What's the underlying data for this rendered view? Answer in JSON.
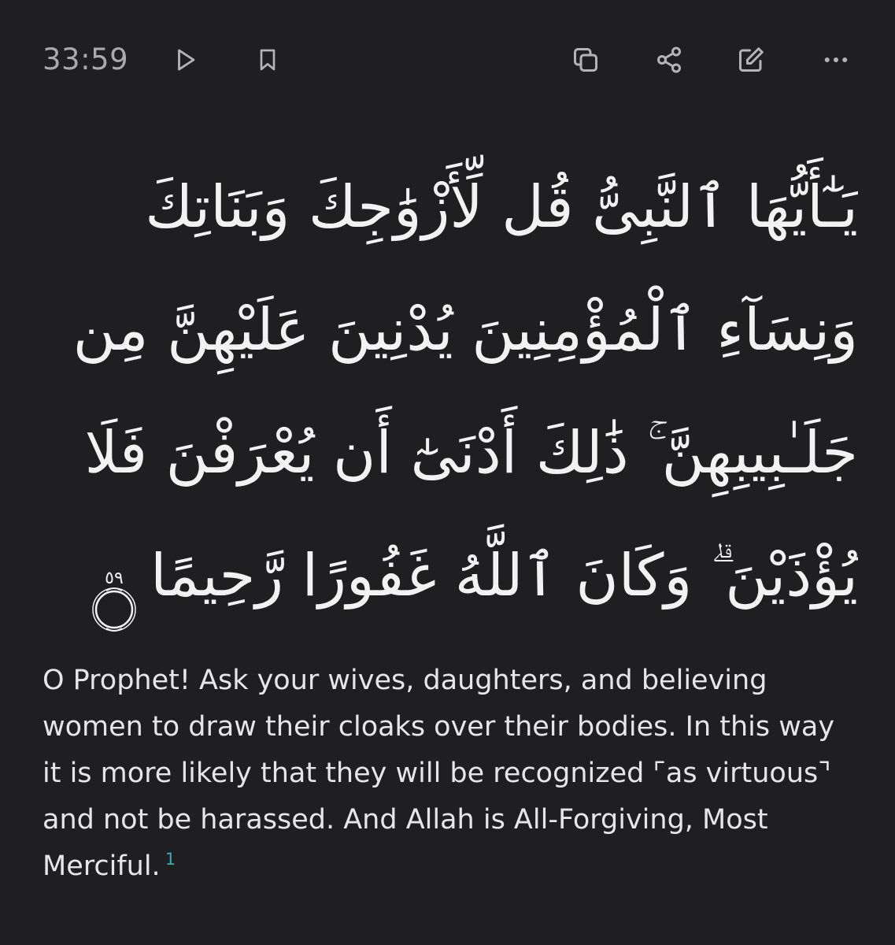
{
  "verse_ref": "33:59",
  "arabic_lines": [
    "يَـٰٓأَيُّهَا ٱلنَّبِىُّ قُل لِّأَزْوَٰجِكَ وَبَنَاتِكَ",
    "وَنِسَآءِ ٱلْمُؤْمِنِينَ يُدْنِينَ عَلَيْهِنَّ مِن",
    "جَلَـٰبِيبِهِنَّ ۚ ذَٰلِكَ أَدْنَىٰٓ أَن يُعْرَفْنَ فَلَا",
    "يُؤْذَيْنَ ۗ وَكَانَ ٱللَّهُ غَفُورًا رَّحِيمًا"
  ],
  "ayah_number": "٥٩",
  "translation": "O Prophet! Ask your wives, daughters, and believing women to draw their cloaks over their bodies. In this way it is more likely that they will be recognized ⌜as virtuous⌝ and not be harassed. And Allah is All-Forgiving, Most Merciful.",
  "footnote_marker": "1",
  "icons": {
    "play": "play-icon",
    "bookmark": "bookmark-icon",
    "copy": "copy-icon",
    "share": "share-icon",
    "edit": "edit-icon",
    "more": "more-icon"
  },
  "colors": {
    "background": "#1f1f22",
    "icon": "#b4b4b8",
    "text": "#e6e6e8",
    "footnote": "#3fa7b5"
  }
}
